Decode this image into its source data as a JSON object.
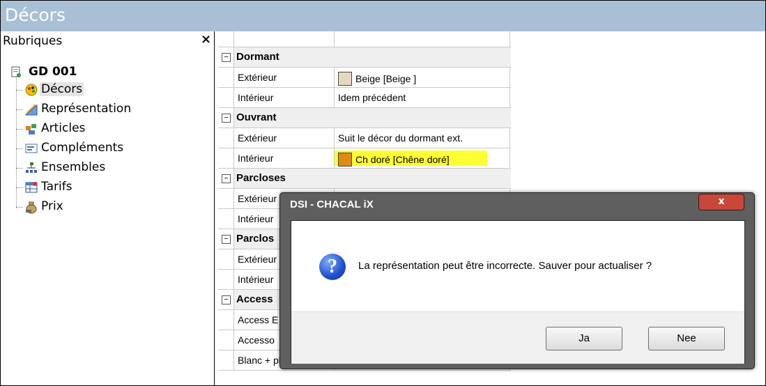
{
  "window": {
    "title": "Décors"
  },
  "left_panel": {
    "header": "Rubriques",
    "close_label": "×",
    "root": "GD 001",
    "items": [
      {
        "label": "Décors",
        "icon": "palette-icon",
        "selected": true
      },
      {
        "label": "Représentation",
        "icon": "ruler-icon",
        "selected": false
      },
      {
        "label": "Articles",
        "icon": "parts-icon",
        "selected": false
      },
      {
        "label": "Compléments",
        "icon": "form-icon",
        "selected": false
      },
      {
        "label": "Ensembles",
        "icon": "hierarchy-icon",
        "selected": false
      },
      {
        "label": "Tarifs",
        "icon": "table-icon",
        "selected": false
      },
      {
        "label": "Prix",
        "icon": "money-bag-icon",
        "selected": false
      }
    ]
  },
  "grid": {
    "toggle_symbol": "−",
    "rows": [
      {
        "type": "category",
        "name": "Dormant"
      },
      {
        "type": "prop",
        "name": "Extérieur",
        "value": "Beige [Beige ]",
        "swatch": "#e6d8c0"
      },
      {
        "type": "prop",
        "name": "Intérieur",
        "value": "Idem précédent"
      },
      {
        "type": "category",
        "name": "Ouvrant"
      },
      {
        "type": "prop",
        "name": "Extérieur",
        "value": "Suit le décor du dormant ext."
      },
      {
        "type": "prop",
        "name": "Intérieur",
        "value": "Ch doré [Chêne doré]",
        "swatch": "#e08a12",
        "highlight": "#ffff33"
      },
      {
        "type": "category",
        "name": "Parcloses"
      },
      {
        "type": "prop",
        "name": "Extérieur",
        "value": ""
      },
      {
        "type": "prop",
        "name": "Intérieur",
        "value": ""
      },
      {
        "type": "category",
        "name": "Parclos"
      },
      {
        "type": "prop",
        "name": "Extérieur",
        "value": ""
      },
      {
        "type": "prop",
        "name": "Intérieur",
        "value": ""
      },
      {
        "type": "category",
        "name": "Access"
      },
      {
        "type": "prop",
        "name": "Access E",
        "value": ""
      },
      {
        "type": "prop",
        "name": "Accesso",
        "value": ""
      },
      {
        "type": "prop",
        "name": "Blanc + plaxés",
        "value": ""
      }
    ]
  },
  "dialog": {
    "title": "DSI - CHACAL iX",
    "close_label": "x",
    "message": "La représentation peut être incorrecte. Sauver pour actualiser ?",
    "icon_glyph": "?",
    "buttons": {
      "yes": "Ja",
      "no": "Nee"
    }
  }
}
